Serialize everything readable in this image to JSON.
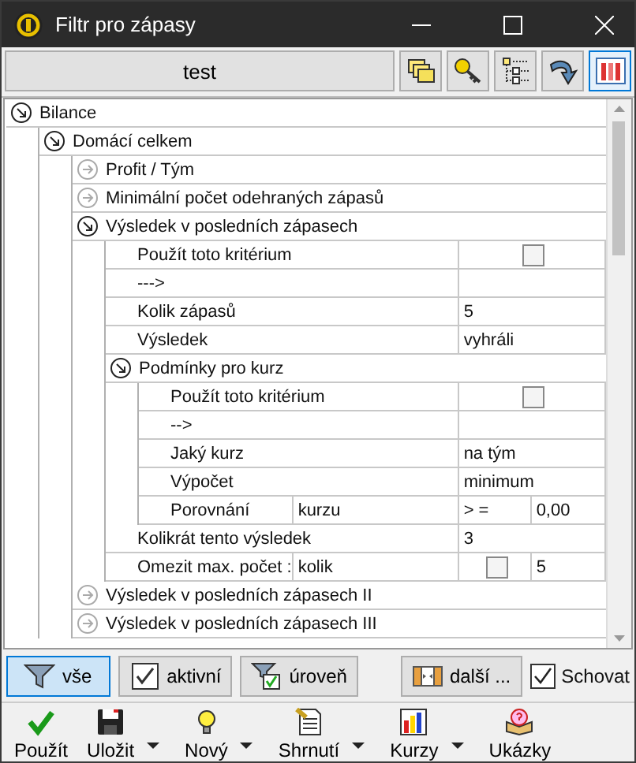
{
  "window": {
    "title": "Filtr pro zápasy"
  },
  "toolbar": {
    "profile": "test",
    "icons": [
      {
        "kind": "folders",
        "selected": false
      },
      {
        "kind": "key",
        "selected": false
      },
      {
        "kind": "tree",
        "selected": false
      },
      {
        "kind": "arrow",
        "selected": false
      },
      {
        "kind": "bars",
        "selected": true
      }
    ]
  },
  "tree": [
    {
      "kind": "group",
      "label": "Bilance",
      "expanded": true,
      "children": [
        {
          "kind": "group",
          "label": "Domácí celkem",
          "expanded": true,
          "children": [
            {
              "kind": "group",
              "label": "Profit / Tým",
              "expanded": false
            },
            {
              "kind": "group",
              "label": "Minimální počet odehraných zápasů",
              "expanded": false
            },
            {
              "kind": "group",
              "label": "Výsledek v posledních zápasech",
              "expanded": true,
              "children": [
                {
                  "kind": "property",
                  "cells": [
                    {
                      "kind": "text",
                      "text": "Použít toto kritérium"
                    },
                    {
                      "kind": "checkbox",
                      "checked": false
                    }
                  ]
                },
                {
                  "kind": "property",
                  "cells": [
                    {
                      "kind": "text",
                      "text": "--->"
                    },
                    {
                      "kind": "empty"
                    }
                  ]
                },
                {
                  "kind": "property",
                  "cells": [
                    {
                      "kind": "text",
                      "text": "Kolik zápasů"
                    },
                    {
                      "kind": "text",
                      "text": "5"
                    }
                  ]
                },
                {
                  "kind": "property",
                  "cells": [
                    {
                      "kind": "text",
                      "text": "Výsledek"
                    },
                    {
                      "kind": "text",
                      "text": "vyhráli"
                    }
                  ]
                },
                {
                  "kind": "group",
                  "label": "Podmínky pro kurz",
                  "expanded": true,
                  "children": [
                    {
                      "kind": "property",
                      "cells": [
                        {
                          "kind": "text",
                          "text": "Použít toto kritérium"
                        },
                        {
                          "kind": "checkbox",
                          "checked": false
                        }
                      ]
                    },
                    {
                      "kind": "property",
                      "cells": [
                        {
                          "kind": "text",
                          "text": "-->"
                        },
                        {
                          "kind": "empty"
                        }
                      ]
                    },
                    {
                      "kind": "property",
                      "cells": [
                        {
                          "kind": "text",
                          "text": "Jaký kurz"
                        },
                        {
                          "kind": "text",
                          "text": "na tým"
                        }
                      ]
                    },
                    {
                      "kind": "property",
                      "cells": [
                        {
                          "kind": "text",
                          "text": "Výpočet"
                        },
                        {
                          "kind": "text",
                          "text": "minimum"
                        }
                      ]
                    },
                    {
                      "kind": "property",
                      "cells": [
                        {
                          "kind": "text",
                          "text": "Porovnání"
                        },
                        {
                          "kind": "text",
                          "text": "kurzu"
                        },
                        {
                          "kind": "text",
                          "text": "> ="
                        },
                        {
                          "kind": "text",
                          "text": "0,00"
                        }
                      ]
                    }
                  ]
                },
                {
                  "kind": "property",
                  "cells": [
                    {
                      "kind": "text",
                      "text": "Kolikrát tento výsledek"
                    },
                    {
                      "kind": "text",
                      "text": "3"
                    }
                  ]
                },
                {
                  "kind": "property",
                  "cells": [
                    {
                      "kind": "text",
                      "text": "Omezit max. počet :"
                    },
                    {
                      "kind": "text",
                      "text": "kolik"
                    },
                    {
                      "kind": "checkbox",
                      "checked": false
                    },
                    {
                      "kind": "text",
                      "text": "5"
                    }
                  ]
                }
              ]
            },
            {
              "kind": "group",
              "label": "Výsledek v posledních zápasech II",
              "expanded": false
            },
            {
              "kind": "group",
              "label": "Výsledek v posledních zápasech III",
              "expanded": false
            }
          ]
        }
      ]
    }
  ],
  "filter_buttons": [
    {
      "kind": "funnel",
      "label": "vše",
      "selected": true
    },
    {
      "kind": "check",
      "label": "aktivní",
      "selected": false
    },
    {
      "kind": "funnel-check",
      "label": "úroveň",
      "selected": false
    },
    {
      "kind": "columns",
      "label": "další ...",
      "selected": false
    }
  ],
  "hide_checkbox": {
    "label": "Schovat",
    "checked": true
  },
  "actions": [
    {
      "kind": "check",
      "label": "Použít",
      "dropdown": false
    },
    {
      "kind": "floppy",
      "label": "Uložit",
      "dropdown": true
    },
    {
      "kind": "bulb",
      "label": "Nový",
      "dropdown": true
    },
    {
      "kind": "report",
      "label": "Shrnutí",
      "dropdown": true
    },
    {
      "kind": "chart",
      "label": "Kurzy",
      "dropdown": true
    },
    {
      "kind": "book",
      "label": "Ukázky",
      "dropdown": false
    }
  ]
}
